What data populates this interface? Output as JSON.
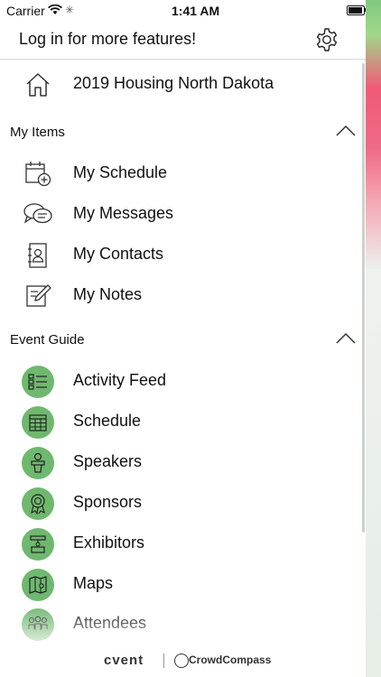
{
  "status": {
    "carrier": "Carrier",
    "time": "1:41 AM"
  },
  "top_bar": {
    "login_text": "Log in for more features!"
  },
  "home": {
    "label": "2019 Housing North Dakota"
  },
  "my_items": {
    "title": "My Items",
    "items": [
      {
        "label": "My Schedule",
        "icon": "calendar-add-icon"
      },
      {
        "label": "My Messages",
        "icon": "chat-bubbles-icon"
      },
      {
        "label": "My Contacts",
        "icon": "address-book-icon"
      },
      {
        "label": "My Notes",
        "icon": "note-pencil-icon"
      }
    ]
  },
  "event_guide": {
    "title": "Event Guide",
    "items": [
      {
        "label": "Activity Feed",
        "icon": "list-icon"
      },
      {
        "label": "Schedule",
        "icon": "calendar-grid-icon"
      },
      {
        "label": "Speakers",
        "icon": "speaker-podium-icon"
      },
      {
        "label": "Sponsors",
        "icon": "ribbon-award-icon"
      },
      {
        "label": "Exhibitors",
        "icon": "exhibitor-booth-icon"
      },
      {
        "label": "Maps",
        "icon": "map-pin-icon"
      },
      {
        "label": "Attendees",
        "icon": "people-group-icon"
      }
    ]
  },
  "footer": {
    "brand1": "cvent",
    "brand2": "CrowdCompass"
  },
  "colors": {
    "accent_green": "#6fb86f",
    "strip_pink": "#f05a78"
  }
}
